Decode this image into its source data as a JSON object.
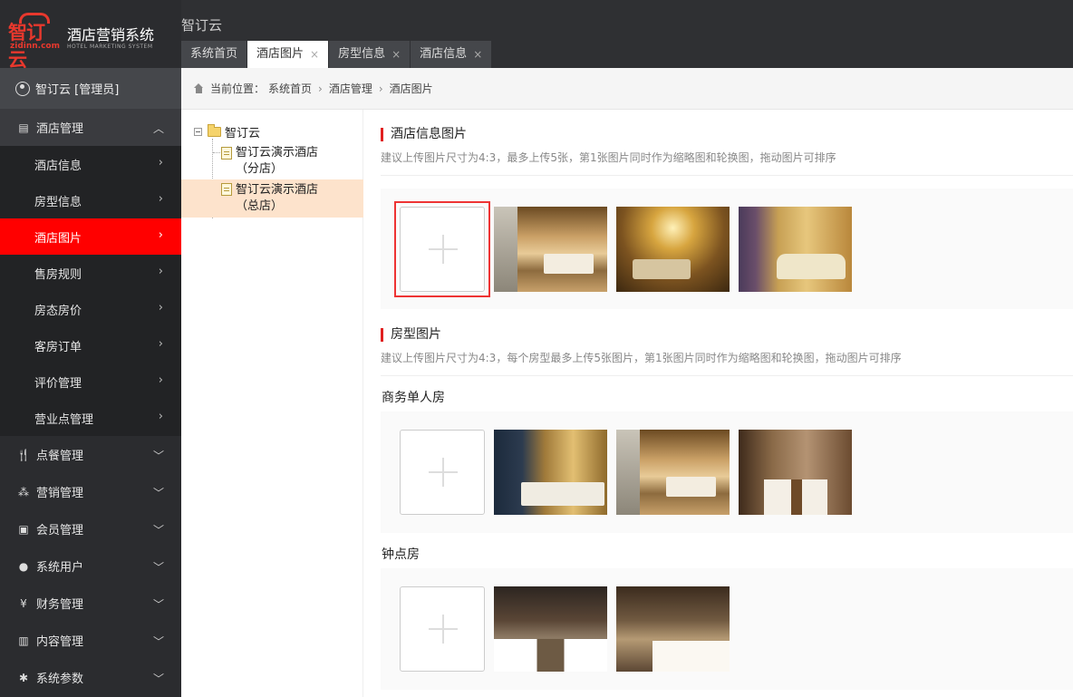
{
  "logo": {
    "brand": "智订云",
    "domain": "zidinn.com",
    "title": "酒店营销系统",
    "subtitle": "HOTEL MARKETING SYSTEM",
    "accent_color": "#e8382d"
  },
  "header": {
    "app_name": "智订云",
    "tabs": [
      {
        "label": "系统首页",
        "closable": false,
        "active": false
      },
      {
        "label": "酒店图片",
        "closable": true,
        "active": true
      },
      {
        "label": "房型信息",
        "closable": true,
        "active": false
      },
      {
        "label": "酒店信息",
        "closable": true,
        "active": false
      }
    ],
    "close_glyph": "×"
  },
  "sidebar": {
    "user": "智订云 [管理员]",
    "active_color": "#ff0000",
    "hotel_menu": {
      "label": "酒店管理",
      "icon": "building-icon",
      "expanded": true
    },
    "sub_items": [
      {
        "label": "酒店信息",
        "active": false
      },
      {
        "label": "房型信息",
        "active": false
      },
      {
        "label": "酒店图片",
        "active": true
      },
      {
        "label": "售房规则",
        "active": false
      },
      {
        "label": "房态房价",
        "active": false
      },
      {
        "label": "客房订单",
        "active": false
      },
      {
        "label": "评价管理",
        "active": false
      },
      {
        "label": "营业点管理",
        "active": false
      }
    ],
    "menus": [
      {
        "label": "点餐管理",
        "icon": "cutlery-icon"
      },
      {
        "label": "营销管理",
        "icon": "network-icon"
      },
      {
        "label": "会员管理",
        "icon": "id-card-icon"
      },
      {
        "label": "系统用户",
        "icon": "user-icon"
      },
      {
        "label": "财务管理",
        "icon": "yen-icon"
      },
      {
        "label": "内容管理",
        "icon": "document-icon"
      },
      {
        "label": "系统参数",
        "icon": "gear-icon"
      }
    ]
  },
  "breadcrumb": {
    "prefix": "当前位置：",
    "items": [
      "系统首页",
      "酒店管理",
      "酒店图片"
    ],
    "separator": "›"
  },
  "tree": {
    "root": "智订云",
    "nodes": [
      {
        "label": "智订云演示酒店（分店）",
        "selected": false
      },
      {
        "label": "智订云演示酒店（总店）",
        "selected": true
      }
    ]
  },
  "hotel_images": {
    "title": "酒店信息图片",
    "hint": "建议上传图片尺寸为4:3，最多上传5张，第1张图片同时作为缩略图和轮换图，拖动图片可排序",
    "photos": [
      "lobby-dining-photo",
      "lounge-chandelier-photo",
      "sofa-suite-photo"
    ]
  },
  "room_images": {
    "title": "房型图片",
    "hint": "建议上传图片尺寸为4:3，每个房型最多上传5张图片，第1张图片同时作为缩略图和轮换图，拖动图片可排序",
    "groups": [
      {
        "name": "商务单人房",
        "photos": [
          "business-room-window-photo",
          "business-room-dining-photo",
          "business-room-bed-photo"
        ]
      },
      {
        "name": "钟点房",
        "photos": [
          "hourly-room-twin-photo",
          "hourly-room-bed-photo"
        ]
      }
    ]
  }
}
